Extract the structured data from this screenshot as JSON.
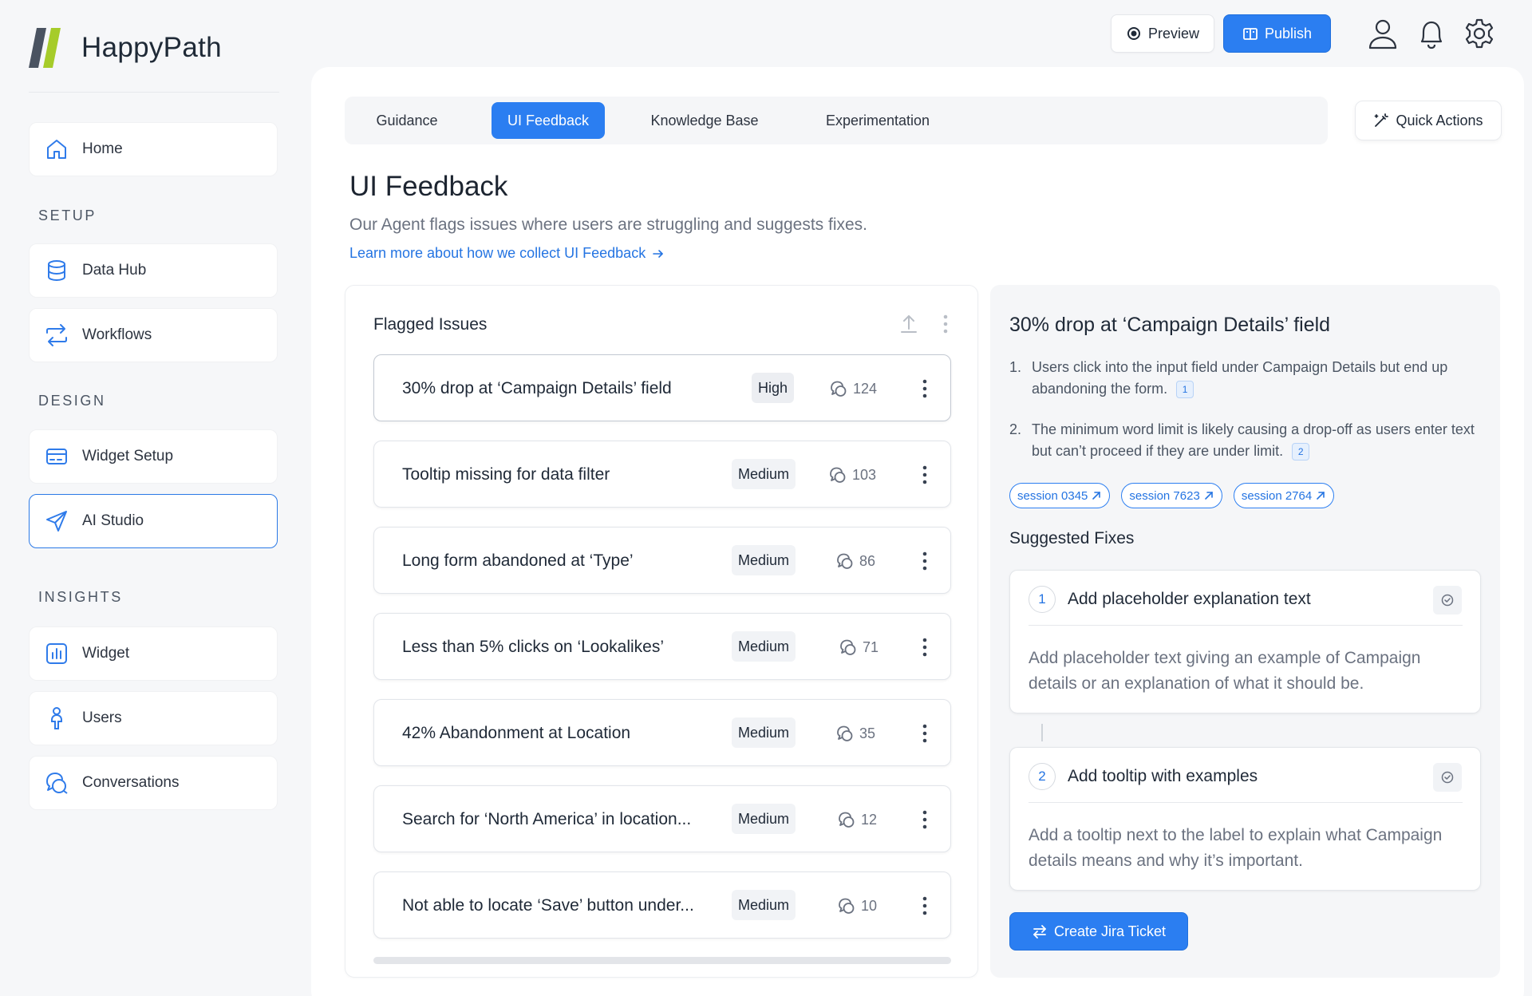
{
  "app": {
    "name": "HappyPath"
  },
  "sidebar": {
    "home": "Home",
    "sections": {
      "setup": "SETUP",
      "design": "DESIGN",
      "insights": "INSIGHTS"
    },
    "setup_items": [
      {
        "label": "Data Hub",
        "icon": "database-icon"
      },
      {
        "label": "Workflows",
        "icon": "workflow-arrows-icon"
      }
    ],
    "design_items": [
      {
        "label": "Widget Setup",
        "icon": "widget-card-icon"
      },
      {
        "label": "AI Studio",
        "icon": "paper-plane-icon",
        "active": true
      }
    ],
    "insights_items": [
      {
        "label": "Widget",
        "icon": "bar-chart-icon"
      },
      {
        "label": "Users",
        "icon": "user-icon"
      },
      {
        "label": "Conversations",
        "icon": "chat-bubbles-icon"
      }
    ]
  },
  "topbar": {
    "preview_label": "Preview",
    "publish_label": "Publish",
    "icons": [
      "profile-icon",
      "bell-icon",
      "gear-icon"
    ]
  },
  "tabs": [
    {
      "label": "Guidance"
    },
    {
      "label": "UI Feedback",
      "active": true
    },
    {
      "label": "Knowledge Base"
    },
    {
      "label": "Experimentation"
    }
  ],
  "quick_actions_label": "Quick Actions",
  "page": {
    "title": "UI Feedback",
    "subtitle": "Our Agent flags issues where users are struggling and suggests fixes.",
    "learn_link": "Learn more about how we collect UI Feedback"
  },
  "issues_panel": {
    "title": "Flagged Issues",
    "issues": [
      {
        "title": "30% drop at ‘Campaign Details’ field",
        "severity": "High",
        "count": "124"
      },
      {
        "title": "Tooltip missing for data filter",
        "severity": "Medium",
        "count": "103"
      },
      {
        "title": "Long form abandoned at ‘Type’",
        "severity": "Medium",
        "count": "86"
      },
      {
        "title": "Less than 5% clicks on ‘Lookalikes’",
        "severity": "Medium",
        "count": "71"
      },
      {
        "title": "42% Abandonment at Location",
        "severity": "Medium",
        "count": "35"
      },
      {
        "title": "Search for ‘North America’ in location...",
        "severity": "Medium",
        "count": "12"
      },
      {
        "title": "Not able to locate ‘Save’ button under...",
        "severity": "Medium",
        "count": "10"
      }
    ]
  },
  "detail": {
    "title": "30% drop at ‘Campaign Details’ field",
    "points": [
      {
        "num": "1.",
        "text": "Users click into the input field under Campaign Details but end up abandoning the form.",
        "ref": "1"
      },
      {
        "num": "2.",
        "text": "The minimum word limit is likely causing a drop-off as users enter text but can’t proceed if they are under limit.",
        "ref": "2"
      }
    ],
    "sessions": [
      "session 0345",
      "session 7623",
      "session 2764"
    ],
    "fixes_label": "Suggested Fixes",
    "fixes": [
      {
        "num": "1",
        "title": "Add placeholder explanation text",
        "body": "Add placeholder text giving an example of Campaign details or an explanation of what it should be."
      },
      {
        "num": "2",
        "title": "Add tooltip with examples",
        "body": "Add a tooltip next to the label to explain what Campaign details means and why it’s important."
      }
    ],
    "jira_label": "Create Jira Ticket"
  },
  "colors": {
    "accent": "#2b7ef1",
    "brand_dark": "#4a5361",
    "brand_green": "#a6cc2a"
  }
}
